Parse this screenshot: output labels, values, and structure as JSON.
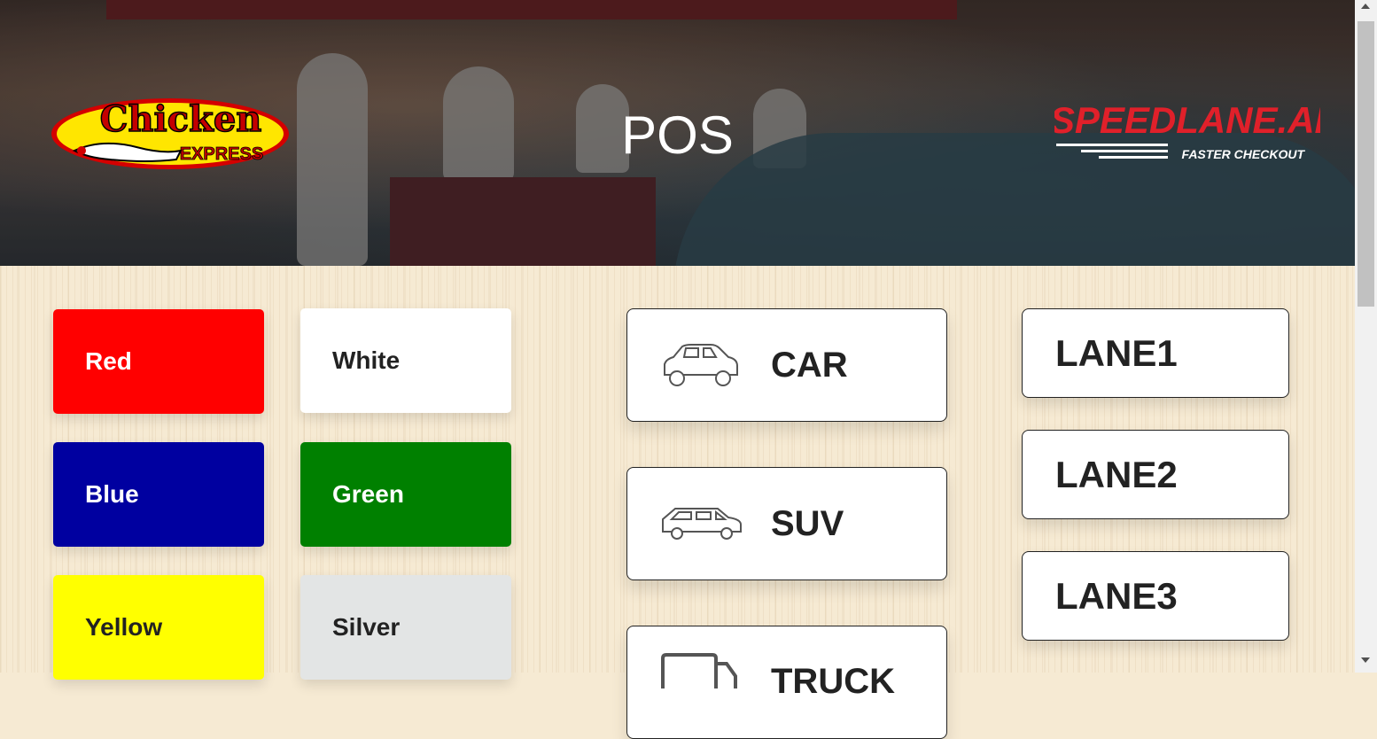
{
  "header": {
    "title": "POS",
    "left_logo": {
      "line1": "Chicken",
      "line2": "EXPRESS"
    },
    "right_logo": {
      "name": "SPEEDLANE.AI",
      "tagline": "FASTER CHECKOUT"
    }
  },
  "colors": [
    {
      "label": "Red",
      "bg": "#ff0000",
      "fg": "#ffffff"
    },
    {
      "label": "White",
      "bg": "#ffffff",
      "fg": "#222222"
    },
    {
      "label": "Blue",
      "bg": "#0000a0",
      "fg": "#ffffff"
    },
    {
      "label": "Green",
      "bg": "#008000",
      "fg": "#ffffff"
    },
    {
      "label": "Yellow",
      "bg": "#ffff00",
      "fg": "#222222"
    },
    {
      "label": "Silver",
      "bg": "#e3e5e5",
      "fg": "#222222"
    }
  ],
  "vehicles": [
    {
      "label": "CAR",
      "icon": "car-icon"
    },
    {
      "label": "SUV",
      "icon": "suv-icon"
    },
    {
      "label": "TRUCK",
      "icon": "truck-icon"
    }
  ],
  "lanes": [
    {
      "label": "LANE1"
    },
    {
      "label": "LANE2"
    },
    {
      "label": "LANE3"
    }
  ]
}
